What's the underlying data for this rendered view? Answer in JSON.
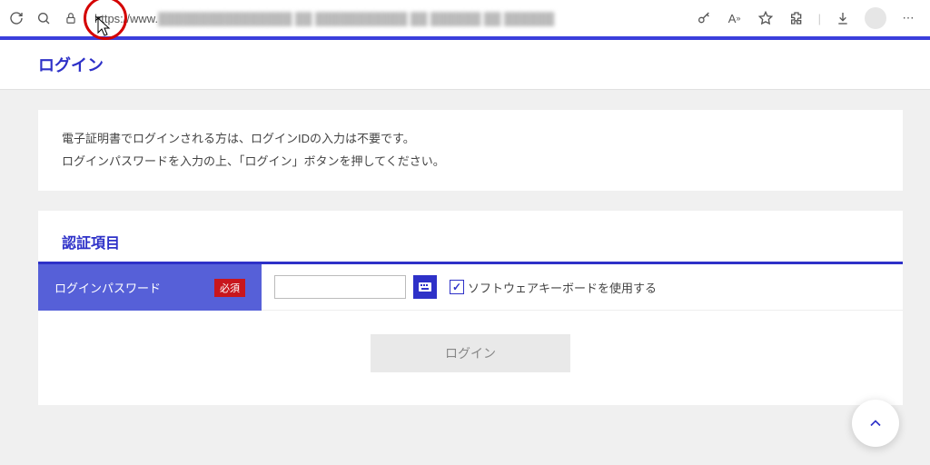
{
  "browser": {
    "url_prefix": "https://www.",
    "url_obscured": "████████████████  ██ ███████████ ██ ██████ ██ ██████"
  },
  "page": {
    "title": "ログイン",
    "notice_line1": "電子証明書でログインされる方は、ログインIDの入力は不要です。",
    "notice_line2": "ログインパスワードを入力の上、「ログイン」ボタンを押してください。",
    "auth_section_title": "認証項目",
    "password_label": "ログインパスワード",
    "required_badge": "必須",
    "use_soft_keyboard": "ソフトウェアキーボードを使用する",
    "login_button": "ログイン"
  }
}
